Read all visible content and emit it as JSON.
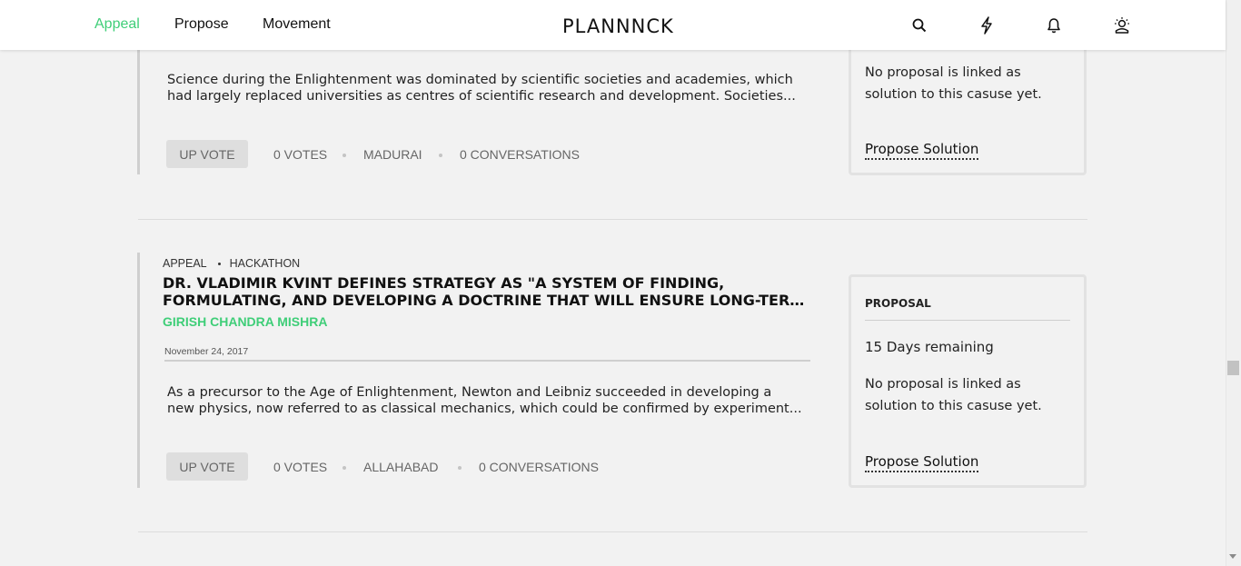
{
  "nav": {
    "appeal": "Appeal",
    "propose": "Propose",
    "movement": "Movement",
    "logo": "PLANNNCK"
  },
  "header_icons": [
    "search-icon",
    "bolt-icon",
    "bell-icon",
    "profile-icon"
  ],
  "colors": {
    "accent": "#3fce78",
    "background": "#f2f2f2",
    "topbar": "#ffffff"
  },
  "posts": [
    {
      "description_line1": "Science during the Enlightenment was dominated by scientific societies and academies, which",
      "description_line2": "had largely replaced universities as centres of scientific research and development. Societies...",
      "upvote": "UP VOTE",
      "votes": "0 VOTES",
      "location": "MADURAI",
      "conversations": "0 CONVERSATIONS",
      "card": {
        "message": "No proposal is linked as solution to this casuse yet.",
        "link": "Propose Solution"
      }
    },
    {
      "category": "APPEAL",
      "tag": "HACKATHON",
      "title_line1": "DR. VLADIMIR KVINT DEFINES STRATEGY AS \"A SYSTEM OF FINDING,",
      "title_line2": "FORMULATING, AND DEVELOPING A DOCTRINE THAT WILL ENSURE LONG-TERM...",
      "author": "GIRISH CHANDRA MISHRA",
      "date": "November 24, 2017",
      "description_line1": "As a precursor to the Age of Enlightenment, Newton and Leibniz succeeded in developing a",
      "description_line2": "new physics, now referred to as classical mechanics, which could be confirmed by experiment...",
      "upvote": "UP VOTE",
      "votes": "0 VOTES",
      "location": "ALLAHABAD",
      "conversations": "0 CONVERSATIONS",
      "card": {
        "heading": "PROPOSAL",
        "remaining": "15 Days remaining",
        "message": "No proposal is linked as solution to this casuse yet.",
        "link": "Propose Solution"
      }
    }
  ]
}
